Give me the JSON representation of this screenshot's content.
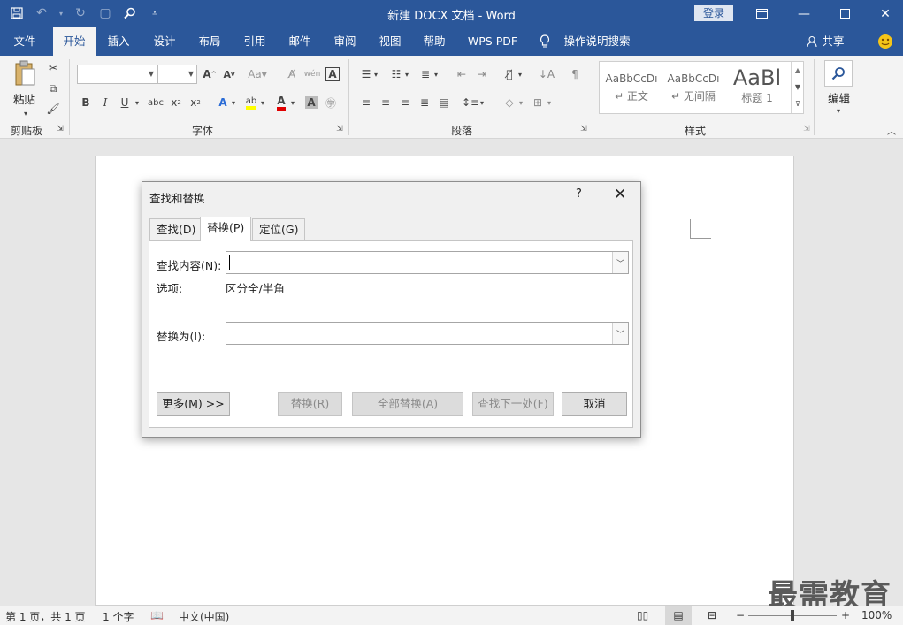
{
  "window": {
    "title": "新建 DOCX 文档  -  Word",
    "login_label": "登录"
  },
  "ribbon_tabs": [
    "文件",
    "开始",
    "插入",
    "设计",
    "布局",
    "引用",
    "邮件",
    "审阅",
    "视图",
    "帮助",
    "WPS PDF",
    "操作说明搜索"
  ],
  "ribbon_right": {
    "share_label": "共享"
  },
  "groups": {
    "clipboard": {
      "label": "剪贴板",
      "paste_label": "粘贴"
    },
    "font": {
      "label": "字体"
    },
    "paragraph": {
      "label": "段落"
    },
    "styles": {
      "label": "样式",
      "items": [
        {
          "preview": "AaBbCcDı",
          "name": "↵ 正文"
        },
        {
          "preview": "AaBbCcDı",
          "name": "↵ 无间隔"
        },
        {
          "preview": "AaBl",
          "name": "标题 1"
        }
      ]
    },
    "editing": {
      "label": "编辑"
    }
  },
  "dialog": {
    "title": "查找和替换",
    "help": "?",
    "tabs": [
      "查找(D)",
      "替换(P)",
      "定位(G)"
    ],
    "find_label": "查找内容(N):",
    "find_value": "",
    "options_label": "选项:",
    "options_value": "区分全/半角",
    "replace_label": "替换为(I):",
    "replace_value": "",
    "buttons": {
      "more": "更多(M) >>",
      "replace": "替换(R)",
      "replace_all": "全部替换(A)",
      "find_next": "查找下一处(F)",
      "cancel": "取消"
    }
  },
  "status": {
    "page": "第 1 页，共 1 页",
    "words": "1 个字",
    "language": "中文(中国)",
    "zoom": "100%"
  },
  "watermark": "最需教育",
  "colors": {
    "accent": "#2b579a"
  }
}
